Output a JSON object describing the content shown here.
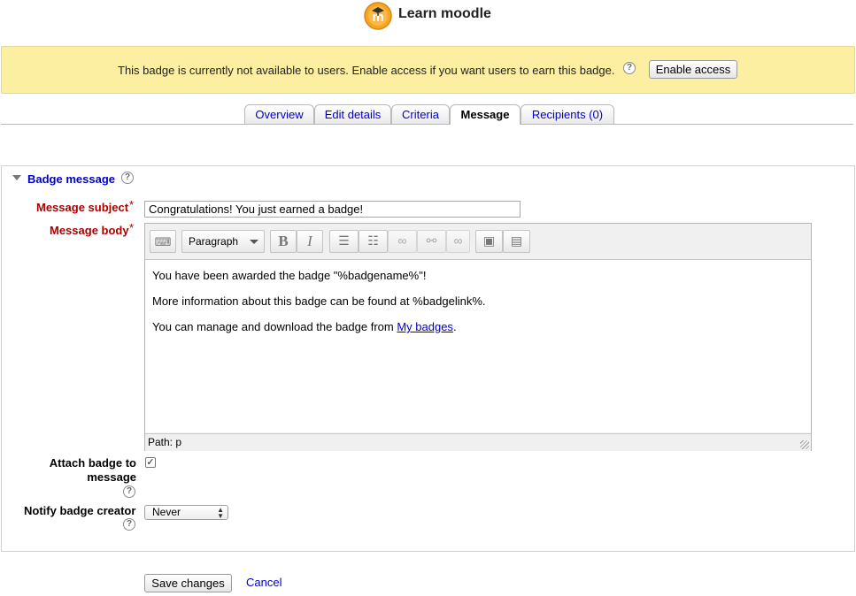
{
  "header": {
    "title": "Learn moodle",
    "logo_letter": "m"
  },
  "notice": {
    "text": "This badge is currently not available to users. Enable access if you want users to earn this badge.",
    "button_label": "Enable access"
  },
  "tabs": [
    {
      "label": "Overview",
      "active": false
    },
    {
      "label": "Edit details",
      "active": false
    },
    {
      "label": "Criteria",
      "active": false
    },
    {
      "label": "Message",
      "active": true
    },
    {
      "label": "Recipients (0)",
      "active": false
    }
  ],
  "form": {
    "legend": "Badge message",
    "subject_label": "Message subject",
    "subject_value": "Congratulations! You just earned a badge!",
    "body_label": "Message body",
    "required_mark": "*",
    "editor": {
      "format": "Paragraph",
      "paragraphs": [
        "You have been awarded the badge \"%badgename%\"!",
        "More information about this badge can be found at %badgelink%."
      ],
      "para3_text": "You can manage and download the badge from ",
      "para3_link": "My badges",
      "para3_end": ".",
      "path": "Path: p"
    },
    "attach_label_line1": "Attach badge to",
    "attach_label_line2": "message",
    "attach_checked": true,
    "notify_label": "Notify badge creator",
    "notify_value": "Never"
  },
  "actions": {
    "save_label": "Save changes",
    "cancel_label": "Cancel"
  },
  "colors": {
    "notice_bg": "#fcefa1",
    "link": "#0000cc",
    "label_required": "#aa0000",
    "logo": "#f5a623"
  }
}
